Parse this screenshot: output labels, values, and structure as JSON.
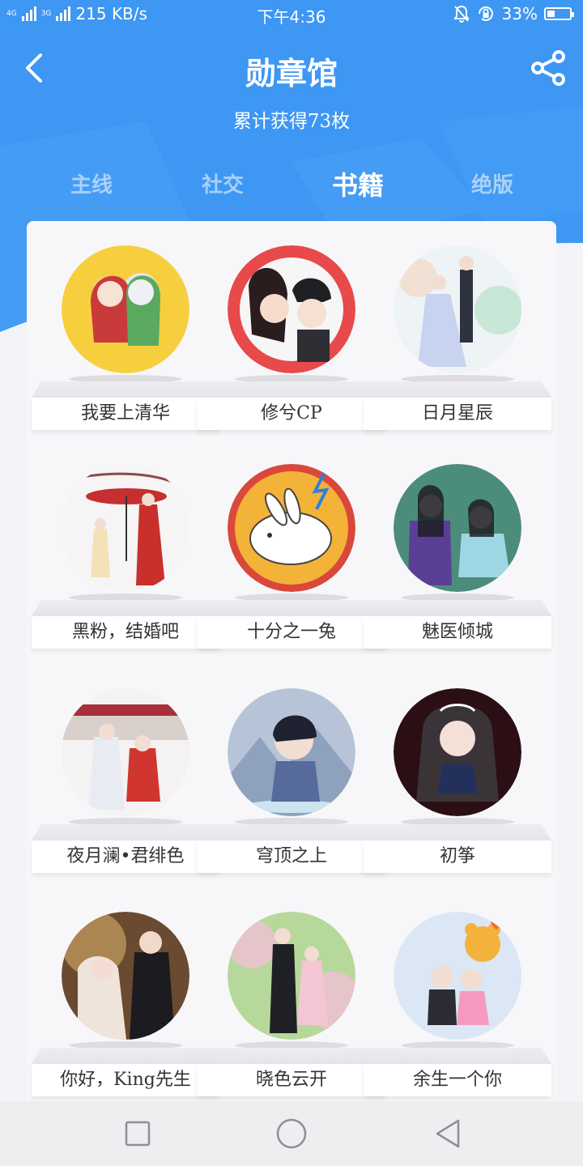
{
  "status_bar": {
    "network_tag_1": "4G",
    "network_tag_2": "3G",
    "speed": "215 KB/s",
    "time": "下午4:36",
    "battery": "33%",
    "battery_level": 0.33,
    "icons": [
      "signal-icon",
      "mute-bell-icon",
      "rotation-lock-icon",
      "battery-icon"
    ]
  },
  "header": {
    "title": "勋章馆",
    "subtitle": "累计获得73枚",
    "back_icon": "chevron-left-icon",
    "share_icon": "share-icon"
  },
  "tabs": [
    {
      "label": "主线",
      "active": false
    },
    {
      "label": "社交",
      "active": false
    },
    {
      "label": "书籍",
      "active": true
    },
    {
      "label": "绝版",
      "active": false
    }
  ],
  "badges": [
    {
      "name": "我要上清华"
    },
    {
      "name": "修兮CP"
    },
    {
      "name": "日月星辰"
    },
    {
      "name": "黑粉，结婚吧"
    },
    {
      "name": "十分之一兔"
    },
    {
      "name": "魅医倾城"
    },
    {
      "name": "夜月澜•君绯色"
    },
    {
      "name": "穹顶之上"
    },
    {
      "name": "初筝"
    },
    {
      "name": "你好，King先生"
    },
    {
      "name": "晓色云开"
    },
    {
      "name": "余生一个你"
    }
  ],
  "nav_bar": {
    "icons": [
      "square-icon",
      "circle-icon",
      "triangle-back-icon"
    ]
  },
  "colors": {
    "header_blue": "#3d97f3",
    "background": "#f3f4f8"
  }
}
